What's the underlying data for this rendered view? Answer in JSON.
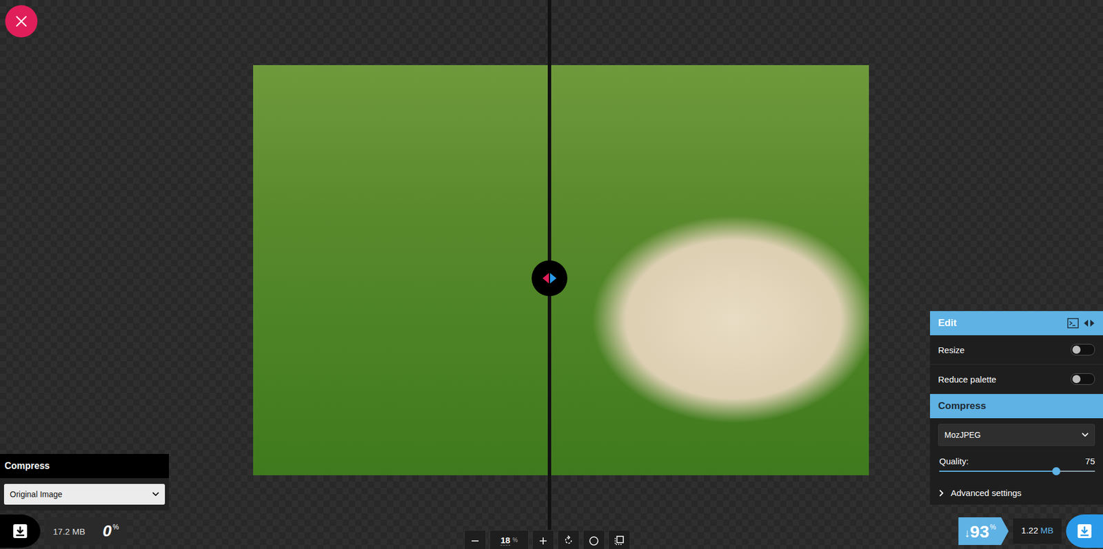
{
  "original": {
    "compress_title": "Compress",
    "method": "Original Image",
    "size": "17.2 MB",
    "savings": "0",
    "savings_unit": "%"
  },
  "viewer": {
    "zoom": "18",
    "zoom_unit": "%"
  },
  "edit": {
    "title": "Edit",
    "options": [
      {
        "label": "Resize",
        "on": false
      },
      {
        "label": "Reduce palette",
        "on": false
      }
    ],
    "compress_title": "Compress",
    "codec": "MozJPEG",
    "quality": {
      "label": "Quality:",
      "value": "75",
      "level": 0.75
    },
    "advanced": "Advanced settings",
    "savings": {
      "arrow": "↓",
      "value": "93",
      "unit": "%"
    },
    "size": {
      "value": "1.22",
      "unit": "MB"
    }
  }
}
